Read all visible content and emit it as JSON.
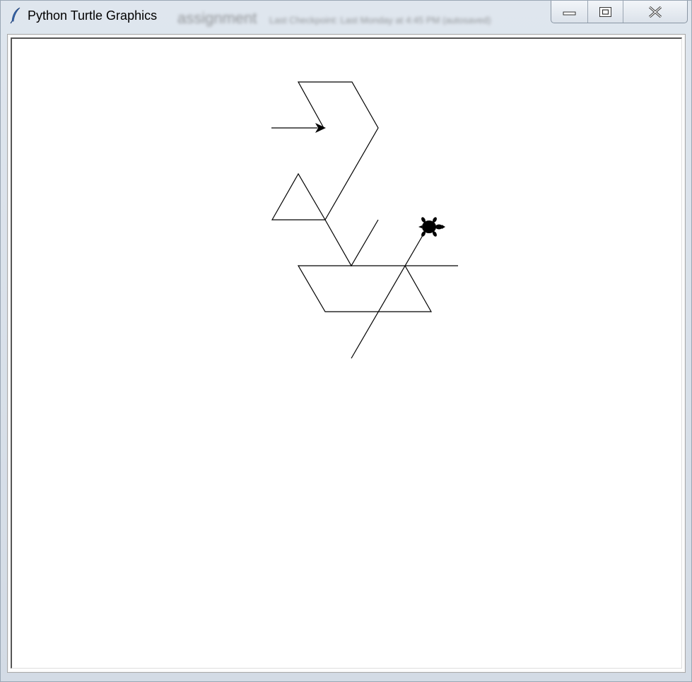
{
  "window": {
    "title": "Python Turtle Graphics",
    "background_text_large": "assignment",
    "background_text_small": "Last Checkpoint: Last Monday at 4:45 PM (autosaved)"
  },
  "controls": {
    "minimize_icon": "minimize-icon",
    "maximize_icon": "maximize-icon",
    "close_icon": "close-icon"
  },
  "canvas": {
    "background": "#ffffff",
    "stroke_color": "#000000",
    "turtle_color": "#000000"
  }
}
